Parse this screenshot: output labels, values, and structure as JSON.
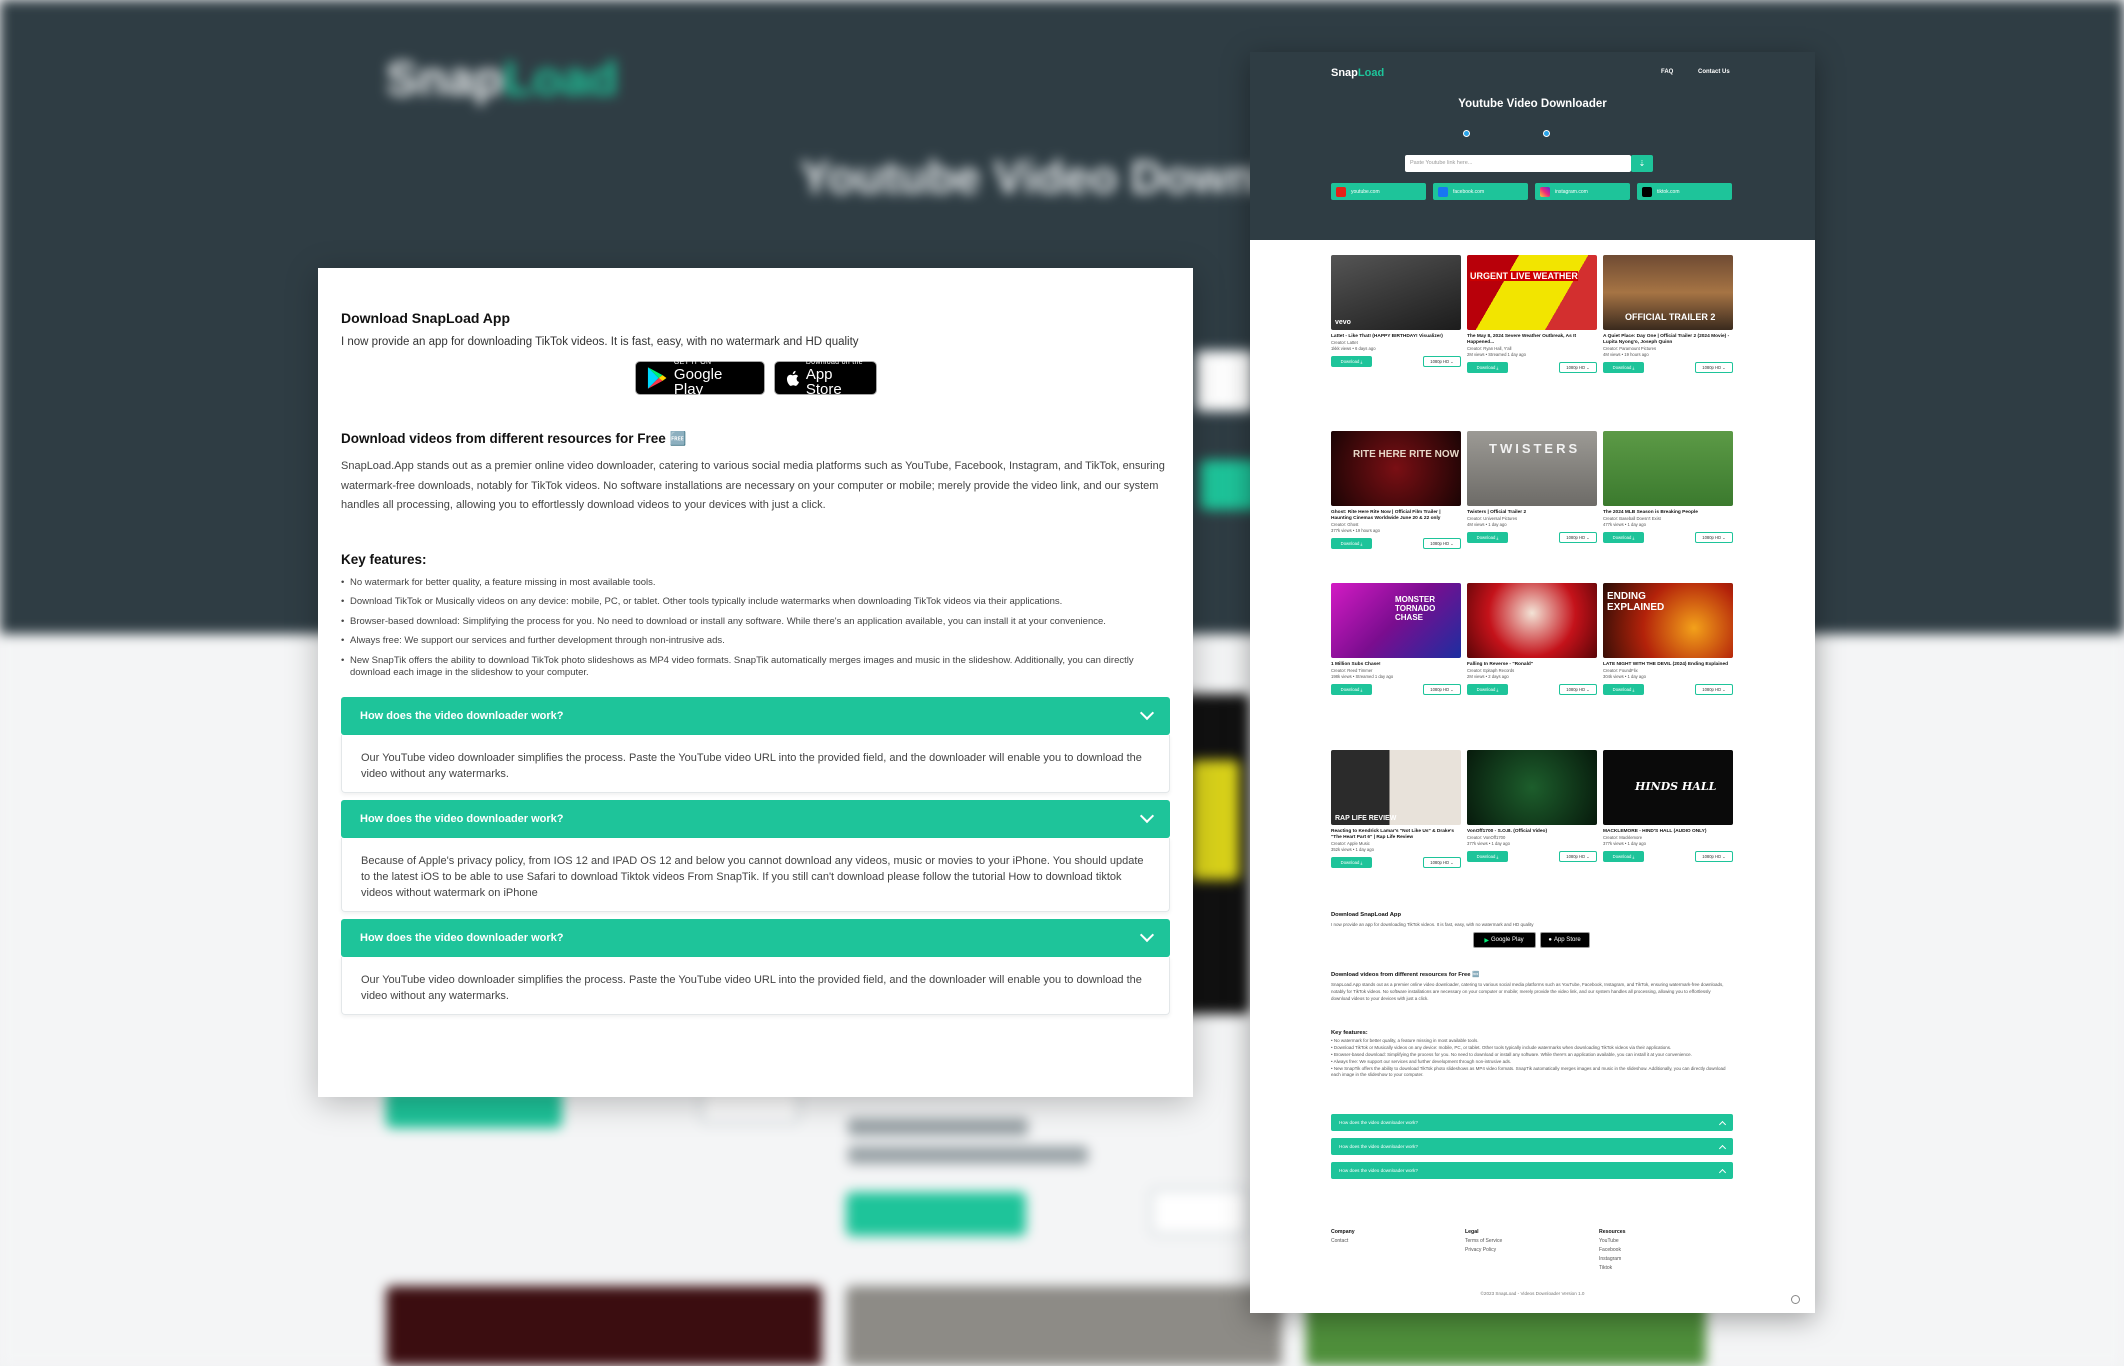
{
  "background": {
    "logo": {
      "part1": "Snap",
      "part2": "Load"
    },
    "title": "Youtube Video Downlo"
  },
  "panel": {
    "app_title": "Download SnapLoad App",
    "app_subtitle": "I now provide an app for downloading TikTok videos. It is fast, easy, with no watermark and HD quality",
    "google_play": {
      "small": "GET IT ON",
      "big": "Google Play"
    },
    "app_store": {
      "small": "Download on the",
      "big": "App Store"
    },
    "resources_title": "Download videos from different resources for Free 🆓",
    "resources_text": "SnapLoad.App stands out as a premier online video downloader, catering to various social media platforms such as YouTube, Facebook, Instagram, and TikTok, ensuring watermark-free downloads, notably for TikTok videos. No software installations are necessary on your computer or mobile; merely provide the video link, and our system handles all processing, allowing you to effortlessly download videos to your devices with just a click.",
    "features_title": "Key features:",
    "features": [
      "No watermark for better quality, a feature missing in most available tools.",
      "Download TikTok or Musically videos on any device: mobile, PC, or tablet. Other tools typically include watermarks when downloading TikTok videos via their applications.",
      "Browser-based download: Simplifying the process for you. No need to download or install any software. While there's an application available, you can install it at your convenience.",
      "Always free: We support our services and further development through non-intrusive ads.",
      "New SnapTik offers the ability to download TikTok photo slideshows as MP4 video formats. SnapTik automatically merges images and music in the slideshow. Additionally, you can directly download each image in the slideshow to your computer."
    ],
    "faq": [
      {
        "q": "How does the video downloader work?",
        "a": "Our YouTube video downloader simplifies the process. Paste the YouTube video URL into the provided field, and the downloader will enable you to download the video without any watermarks."
      },
      {
        "q": "How does the video downloader work?",
        "a": "Because of Apple's privacy policy, from IOS 12 and IPAD OS 12 and below you cannot download any videos, music or movies to your iPhone. You should update to the latest iOS to be able to use Safari to download Tiktok videos From SnapTik. If you still can't download please follow the tutorial How to download tiktok videos without watermark on iPhone"
      },
      {
        "q": "How does the video downloader work?",
        "a": "Our YouTube video downloader simplifies the process. Paste the YouTube video URL into the provided field, and the downloader will enable you to download the video without any watermarks."
      }
    ]
  },
  "mini": {
    "logo": {
      "part1": "Snap",
      "part2": "Load"
    },
    "nav": {
      "faq": "FAQ",
      "contact": "Contact Us"
    },
    "title": "Youtube Video Downloader",
    "features": [
      "• No watermark for better quality, a feature missing in most available tools.",
      "• Download TikTok or Musically videos on any device: mobile, PC, or tablet. Other tools typically include watermarks when downloading TikTok videos via their applications.",
      "• Browser-based download: Simplifying the process for you. No need to download or install any software. While there's an application available, you can install it at your convenience.",
      "• Always free: We support our services and further development through non-intrusive ads.",
      "• New SnapTik offers the ability to download TikTok photo slideshows as MP4 video formats. SnapTik automatically merges images and music in the slideshow. Additionally, you can directly download each image in the slideshow to your computer."
    ],
    "search": {
      "placeholder": "Paste Youtube link here...",
      "button": "⇣"
    },
    "sources": [
      "youtube.com",
      "facebook.com",
      "instagram.com",
      "tiktok.com"
    ],
    "download_label": "Download ⤓",
    "quality_label": "1080p HD ⌄",
    "videos": [
      {
        "title": "Lattet - Like That! (HAPPY BIRTHDAY! Visualizer)",
        "creator": "Creator: Lattet",
        "stats": "1kkk views • 6 days ago",
        "thumb_text": "vevo"
      },
      {
        "title": "The May 8, 2024 Severe Weather Outbreak, As It Happened...",
        "creator": "Creator: Ryan Hall, Y'all",
        "stats": "2M views • Streamed 1 day ago",
        "thumb_text": "URGENT LIVE WEATHER"
      },
      {
        "title": "A Quiet Place: Day One | Official Trailer 2 (2024 Movie) - Lupita Nyong'o, Joseph Quinn",
        "creator": "Creator: Paramount Pictures",
        "stats": "4M views • 19 hours ago",
        "thumb_text": "OFFICIAL TRAILER 2"
      },
      {
        "title": "Ghost: Rite Here Rite Now | Official Film Trailer | Haunting Cinemas Worldwide June 20 & 22 only",
        "creator": "Creator: Ghost",
        "stats": "377k views • 19 hours ago",
        "thumb_text": "RITE HERE RITE NOW"
      },
      {
        "title": "Twisters | Official Trailer 2",
        "creator": "Creator: Universal Pictures",
        "stats": "4M views • 1 day ago",
        "thumb_text": "TWISTERS"
      },
      {
        "title": "The 2024 MLB Season is Breaking People",
        "creator": "Creator: Baseball Doesn't Exist",
        "stats": "477k views • 1 day ago",
        "thumb_text": ""
      },
      {
        "title": "1 Million Subs Chase!",
        "creator": "Creator: Reed Timmer",
        "stats": "198k views • Streamed 1 day ago",
        "thumb_text": "MONSTER TORNADO CHASE"
      },
      {
        "title": "Falling In Reverse - \"Ronald\"",
        "creator": "Creator: Epitaph Records",
        "stats": "2M views • 2 days ago",
        "thumb_text": ""
      },
      {
        "title": "LATE NIGHT WITH THE DEVIL (2024) Ending Explained",
        "creator": "Creator: FoundFlix",
        "stats": "304k views • 1 day ago",
        "thumb_text": "ENDING EXPLAINED"
      },
      {
        "title": "Reacting to Kendrick Lamar's \"Not Like Us\" & Drake's \"The Heart Part 6\" | Rap Life Review",
        "creator": "Creator: Apple Music",
        "stats": "352k views • 1 day ago",
        "thumb_text": "RAP LIFE REVIEW"
      },
      {
        "title": "VonOff1700 - S.O.B. (Official Video)",
        "creator": "Creator: VonOff1700",
        "stats": "377k views • 1 day ago",
        "thumb_text": ""
      },
      {
        "title": "MACKLEMORE - HIND'S HALL (AUDIO ONLY)",
        "creator": "Creator: Macklemore",
        "stats": "377k views • 1 day ago",
        "thumb_text": "HINDS HALL"
      }
    ],
    "app_title": "Download SnapLoad App",
    "app_subtitle": "I now provide an app for downloading TikTok videos. It is fast, easy, with no watermark and HD quality",
    "store_gp": "Google Play",
    "store_as": "App Store",
    "resources_title": "Download videos from different resources for Free 🆓",
    "resources_text": "SnapLoad.App stands out as a premier online video downloader, catering to various social media platforms such as YouTube, Facebook, Instagram, and TikTok, ensuring watermark-free downloads, notably for TikTok videos. No software installations are necessary on your computer or mobile; merely provide the video link, and our system handles all processing, allowing you to effortlessly download videos to your devices with just a click.",
    "features_title": "Key features:",
    "faq": [
      "How does the video downloader work?",
      "How does the video downloader work?",
      "How does the video downloader work?"
    ],
    "footer": {
      "company": {
        "title": "Company",
        "links": [
          "Contact"
        ]
      },
      "legal": {
        "title": "Legal",
        "links": [
          "Terms of Service",
          "Privacy Policy"
        ]
      },
      "resources": {
        "title": "Resources",
        "links": [
          "YouTube",
          "Facebook",
          "Instagram",
          "Tiktok"
        ]
      },
      "copyright": "©2023 SnapLoad - Videos Downloader Version 1.0"
    }
  },
  "colors": {
    "accent": "#1ec49a",
    "header": "#2f3d44"
  }
}
